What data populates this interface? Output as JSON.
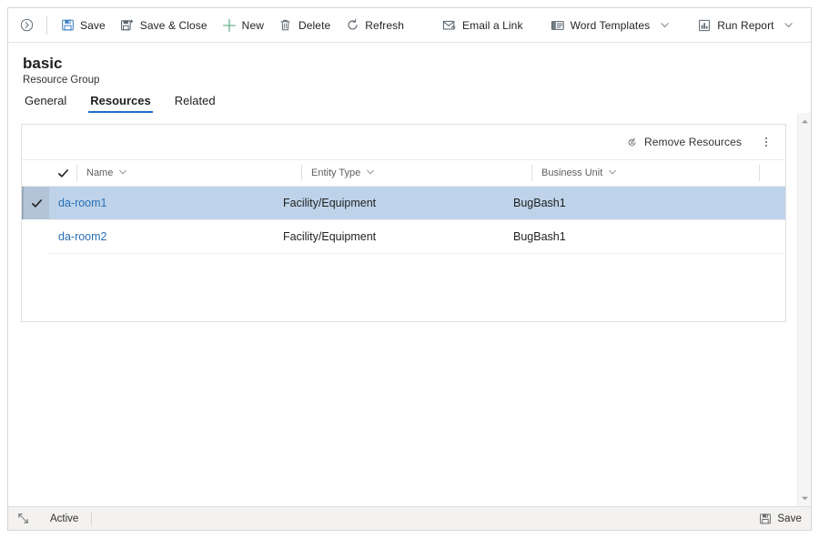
{
  "command_bar": {
    "nav_icon": "back-circle-icon",
    "buttons": [
      {
        "icon": "save-floppy-icon",
        "label": "Save",
        "chevron": false
      },
      {
        "icon": "save-close-icon",
        "label": "Save & Close",
        "chevron": false
      },
      {
        "icon": "plus-icon",
        "label": "New",
        "chevron": false
      },
      {
        "icon": "trash-icon",
        "label": "Delete",
        "chevron": false
      },
      {
        "icon": "refresh-icon",
        "label": "Refresh",
        "chevron": false
      },
      {
        "icon": "email-link-icon",
        "label": "Email a Link",
        "chevron": false
      },
      {
        "icon": "word-template-icon",
        "label": "Word Templates",
        "chevron": true
      },
      {
        "icon": "run-report-icon",
        "label": "Run Report",
        "chevron": true
      }
    ]
  },
  "header": {
    "title": "basic",
    "subtitle": "Resource Group"
  },
  "tabs": [
    {
      "label": "General",
      "active": false
    },
    {
      "label": "Resources",
      "active": true
    },
    {
      "label": "Related",
      "active": false
    }
  ],
  "grid_card": {
    "commands": [
      {
        "icon": "remove-resources-icon",
        "label": "Remove Resources"
      }
    ],
    "overflow_icon": "more-vertical-icon",
    "columns": [
      {
        "key": "check",
        "label": "",
        "sortable": false,
        "icon": "checkmark-icon"
      },
      {
        "key": "name",
        "label": "Name",
        "sortable": true
      },
      {
        "key": "entity",
        "label": "Entity Type",
        "sortable": true
      },
      {
        "key": "bu",
        "label": "Business Unit",
        "sortable": true
      }
    ],
    "rows": [
      {
        "selected": true,
        "checked": true,
        "name": "da-room1",
        "entity": "Facility/Equipment",
        "bu": "BugBash1"
      },
      {
        "selected": false,
        "checked": false,
        "name": "da-room2",
        "entity": "Facility/Equipment",
        "bu": "BugBash1"
      }
    ]
  },
  "scrollbar": {
    "up_icon": "scroll-up-arrow-icon",
    "down_icon": "scroll-down-arrow-icon"
  },
  "status_bar": {
    "resize_icon": "resize-grip-icon",
    "status_text": "Active",
    "save_icon": "save-floppy-icon",
    "save_label": "Save"
  },
  "colors": {
    "accent_blue": "#1a6fc4",
    "link_blue": "#2a6fb5",
    "selection_blue": "#bed3ea",
    "new_green": "#6bb38a",
    "save_icon_blue": "#3f7fc1"
  }
}
